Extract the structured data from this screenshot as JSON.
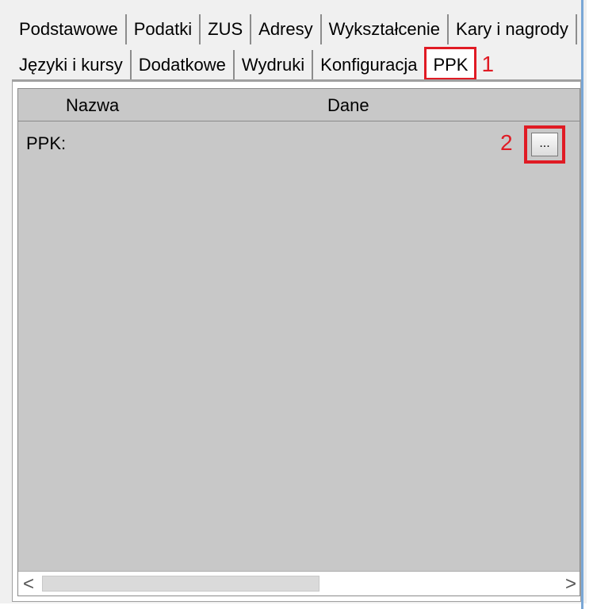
{
  "tabs_row1": [
    "Podstawowe",
    "Podatki",
    "ZUS",
    "Adresy",
    "Wykształcenie",
    "Kary i nagrody"
  ],
  "tabs_row2": [
    "Języki i kursy",
    "Dodatkowe",
    "Wydruki",
    "Konfiguracja"
  ],
  "active_tab": "PPK",
  "annotations": {
    "one": "1",
    "two": "2"
  },
  "grid": {
    "col_name": "Nazwa",
    "col_data": "Dane",
    "row_label": "PPK:",
    "button_label": "..."
  },
  "scroll": {
    "left_arrow": "<",
    "right_arrow": ">"
  },
  "colors": {
    "highlight": "#e01b24",
    "grid_bg": "#c8c8c8"
  }
}
